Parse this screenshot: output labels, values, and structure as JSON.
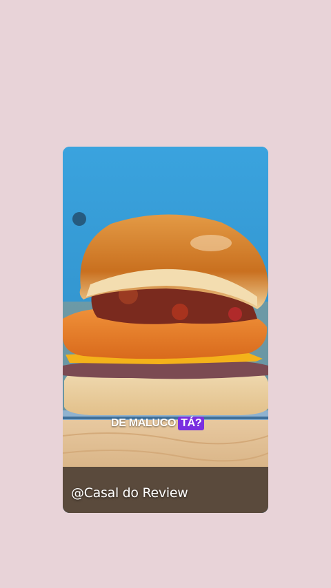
{
  "story": {
    "caption_text": "DE MALUCO",
    "caption_highlight": "TÁ?",
    "watermark": "@Casal do Review"
  },
  "colors": {
    "page_background": "#e8d3d8",
    "photo_wall": "#2f9ad6",
    "caption_highlight_bg": "#7a2fe0"
  }
}
